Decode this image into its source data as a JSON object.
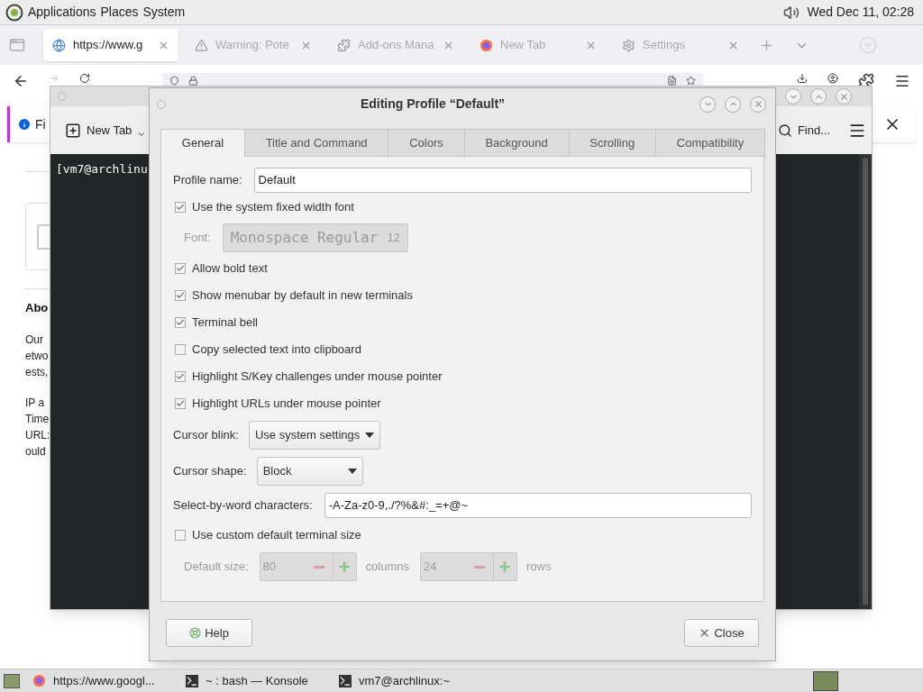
{
  "top_panel": {
    "menus": [
      "Applications",
      "Places",
      "System"
    ],
    "clock": "Wed Dec 11, 02:28"
  },
  "browser": {
    "tabs": [
      {
        "label": "https://www.g",
        "kind": "site",
        "selected": true
      },
      {
        "label": "Warning: Pote",
        "kind": "warning",
        "selected": false
      },
      {
        "label": "Add-ons Mana",
        "kind": "puzzle",
        "selected": false
      },
      {
        "label": "New Tab",
        "kind": "browser",
        "selected": false
      },
      {
        "label": "Settings",
        "kind": "gear",
        "selected": false
      }
    ],
    "notification": "Fi",
    "page": {
      "heading": "Abo",
      "lines": [
        [
          "Our",
          "etwo",
          "ests,"
        ],
        [
          "IP a",
          "Time",
          "URL:",
          "ould"
        ]
      ]
    }
  },
  "terminal_window": {
    "new_tab": "New Tab",
    "find": "Find...",
    "output": "[vm7@archlinu"
  },
  "dialog": {
    "title": "Editing Profile “Default”",
    "tabs": [
      {
        "label": "General",
        "selected": true
      },
      {
        "label": "Title and Command",
        "selected": false
      },
      {
        "label": "Colors",
        "selected": false
      },
      {
        "label": "Background",
        "selected": false
      },
      {
        "label": "Scrolling",
        "selected": false
      },
      {
        "label": "Compatibility",
        "selected": false
      }
    ],
    "rows": [
      {
        "kind": "text",
        "label": "Profile name:",
        "value": "Default"
      },
      {
        "kind": "checkbox",
        "label": "Use the system fixed width font",
        "checked": true
      },
      {
        "kind": "font",
        "label": "Font:",
        "value": "Monospace Regular",
        "size": "12",
        "disabled": true
      },
      {
        "kind": "checkbox",
        "label": "Allow bold text",
        "checked": true
      },
      {
        "kind": "checkbox",
        "label": "Show menubar by default in new terminals",
        "checked": true
      },
      {
        "kind": "checkbox",
        "label": "Terminal bell",
        "checked": true
      },
      {
        "kind": "checkbox",
        "label": "Copy selected text into clipboard",
        "checked": false
      },
      {
        "kind": "checkbox",
        "label": "Highlight S/Key challenges under mouse pointer",
        "checked": true
      },
      {
        "kind": "checkbox",
        "label": "Highlight URLs under mouse pointer",
        "checked": true
      },
      {
        "kind": "dropdown",
        "label": "Cursor blink:",
        "value": "Use system settings"
      },
      {
        "kind": "dropdown",
        "label": "Cursor shape:",
        "value": "Block"
      },
      {
        "kind": "text",
        "label": "Select-by-word characters:",
        "value": "-A-Za-z0-9,./?%&#:_=+@~"
      },
      {
        "kind": "checkbox",
        "label": "Use custom default terminal size",
        "checked": false
      },
      {
        "kind": "size",
        "label": "Default size:",
        "disabled": true,
        "columns": {
          "value": "80",
          "unit": "columns"
        },
        "rows": {
          "value": "24",
          "unit": "rows"
        }
      }
    ],
    "help": "Help",
    "close": "Close"
  },
  "taskbar": {
    "items": [
      {
        "label": "https://www.googl...",
        "kind": "browser"
      },
      {
        "label": "~ : bash — Konsole",
        "kind": "terminal"
      },
      {
        "label": "vm7@archlinux:~",
        "kind": "terminal"
      }
    ]
  }
}
